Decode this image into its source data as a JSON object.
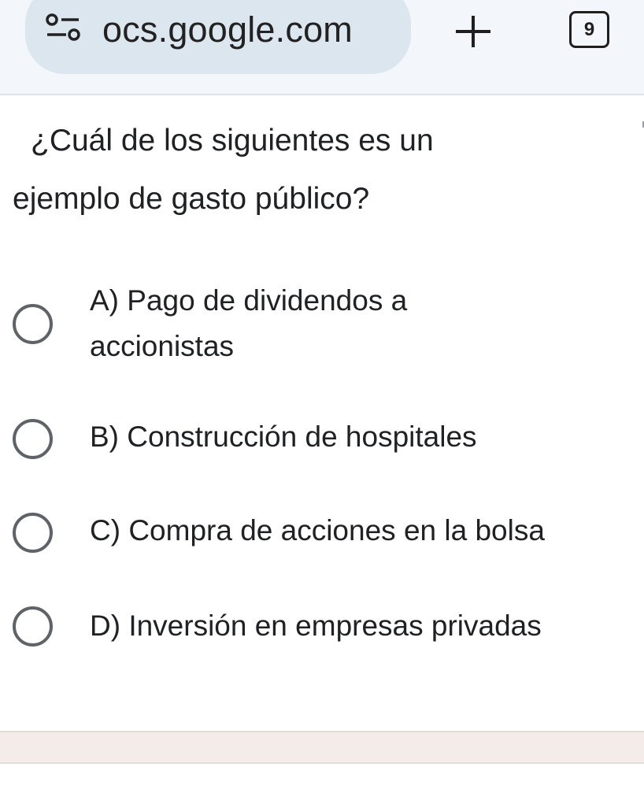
{
  "browser": {
    "url_text": "ocs.google.com",
    "site_icon": "site-settings-icon",
    "new_tab_icon": "plus-icon",
    "tab_count": "9"
  },
  "quiz": {
    "question_line1": "¿Cuál de los siguientes es un",
    "question_line2": "ejemplo de gasto público?",
    "options": [
      {
        "label_line1": "A) Pago de dividendos a",
        "label_line2": "accionistas",
        "selected": false
      },
      {
        "label_line1": "B) Construcción de hospitales",
        "selected": false
      },
      {
        "label_line1": "C) Compra de acciones en la bolsa",
        "selected": false
      },
      {
        "label_line1": "D) Inversión en empresas privadas",
        "selected": false
      }
    ]
  },
  "colors": {
    "radio_border": "#5f6368",
    "url_pill": "#dbe6ee",
    "footer_band": "#f3ece8"
  }
}
